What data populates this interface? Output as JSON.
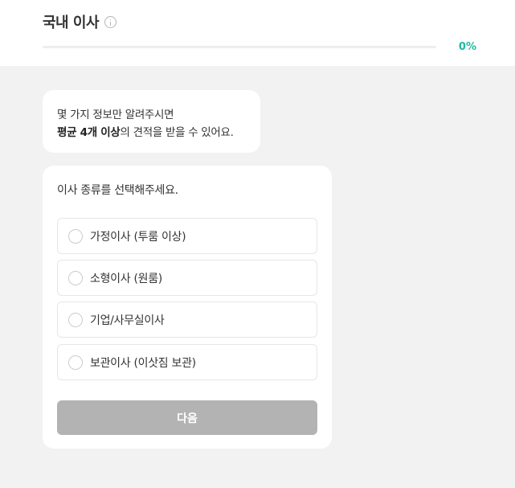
{
  "header": {
    "title": "국내 이사",
    "info_icon": "info-circle-icon",
    "progress": {
      "percent": 0,
      "label": "0%",
      "color": "#1fb9a3"
    }
  },
  "intro": {
    "line1": "몇 가지 정보만 알려주시면",
    "line2_bold": "평균 4개 이상",
    "line2_rest": "의 견적을 받을 수 있어요."
  },
  "question": {
    "text": "이사 종류를 선택해주세요.",
    "options": [
      {
        "label": "가정이사 (투룸 이상)",
        "selected": false
      },
      {
        "label": "소형이사 (원룸)",
        "selected": false
      },
      {
        "label": "기업/사무실이사",
        "selected": false
      },
      {
        "label": "보관이사 (이삿짐 보관)",
        "selected": false
      }
    ]
  },
  "next_button": {
    "label": "다음",
    "enabled": false
  }
}
